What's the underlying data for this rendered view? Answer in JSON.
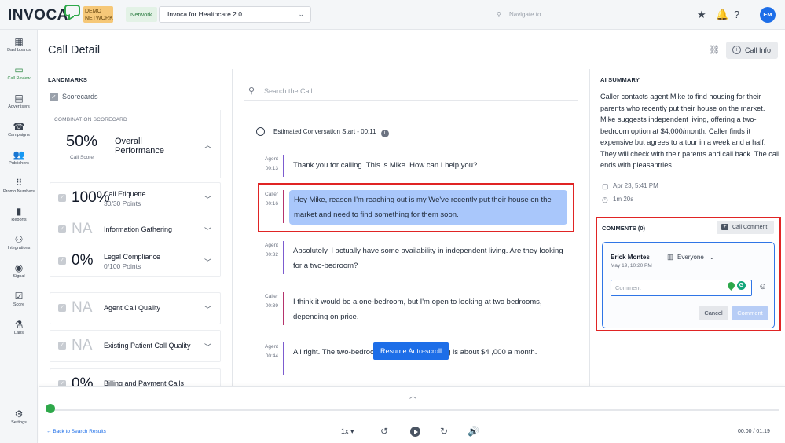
{
  "topbar": {
    "logo": "INVOCA",
    "demo_badge": "DEMO NETWORK",
    "network_label": "Network",
    "network_value": "Invoca for Healthcare 2.0",
    "search_placeholder": "Navigate to...",
    "avatar_initials": "EM"
  },
  "nav": [
    {
      "label": "Dashboards",
      "icon": "dashboard-icon",
      "glyph": "▦"
    },
    {
      "label": "Call Review",
      "icon": "call-review-icon",
      "glyph": "▭"
    },
    {
      "label": "Advertisers",
      "icon": "advertisers-icon",
      "glyph": "▤"
    },
    {
      "label": "Campaigns",
      "icon": "campaigns-icon",
      "glyph": "☎"
    },
    {
      "label": "Publishers",
      "icon": "publishers-icon",
      "glyph": "👥"
    },
    {
      "label": "Promo Numbers",
      "icon": "promo-numbers-icon",
      "glyph": "⠿"
    },
    {
      "label": "Reports",
      "icon": "reports-icon",
      "glyph": "▮"
    },
    {
      "label": "Integrations",
      "icon": "integrations-icon",
      "glyph": "⚇"
    },
    {
      "label": "Signal",
      "icon": "signal-icon",
      "glyph": "◉"
    },
    {
      "label": "Score",
      "icon": "score-icon",
      "glyph": "☑"
    },
    {
      "label": "Labs",
      "icon": "labs-icon",
      "glyph": "⚗"
    },
    {
      "label": "Settings",
      "icon": "settings-icon",
      "glyph": "⚙"
    }
  ],
  "header": {
    "title": "Call Detail",
    "call_info_label": "Call Info"
  },
  "landmarks": {
    "heading": "LANDMARKS",
    "scorecards_label": "Scorecards",
    "combo": {
      "heading": "COMBINATION SCORECARD",
      "percent": "50%",
      "sub": "Call Score",
      "name": "Overall Performance"
    },
    "rows": [
      {
        "pct": "100%",
        "name": "Call Etiquette",
        "sub": "30/30 Points"
      },
      {
        "pct": "NA",
        "name": "Information Gathering",
        "sub": ""
      },
      {
        "pct": "0%",
        "name": "Legal Compliance",
        "sub": "0/100 Points"
      },
      {
        "pct": "NA",
        "name": "Agent Call Quality",
        "sub": ""
      },
      {
        "pct": "NA",
        "name": "Existing Patient Call Quality",
        "sub": ""
      },
      {
        "pct": "0%",
        "name": "Billing and Payment Calls",
        "sub": ""
      }
    ]
  },
  "transcript": {
    "search_placeholder": "Search the Call",
    "estimated_start": "Estimated Conversation Start - 00:11",
    "turns": [
      {
        "speaker": "Agent",
        "time": "00:13",
        "text": "Thank you for calling. This is Mike. How can I help you?"
      },
      {
        "speaker": "Caller",
        "time": "00:16",
        "text": "Hey Mike, reason I'm reaching out is my We've recently put their house on the market and need to find something for them soon."
      },
      {
        "speaker": "Agent",
        "time": "00:32",
        "text": "Absolutely. I actually have some availability in independent living. Are they looking for a two-bedroom?"
      },
      {
        "speaker": "Caller",
        "time": "00:39",
        "text": "I think it would be a one-bedroom, but I'm open to looking at two bedrooms, depending on price."
      },
      {
        "speaker": "Agent",
        "time": "00:44",
        "text": "All right. The two-bedroom in independent living is about $4 ,000 a month."
      }
    ],
    "resume_label": "Resume Auto-scroll"
  },
  "ai_summary": {
    "heading": "AI SUMMARY",
    "text": "Caller contacts agent Mike to find housing for their parents who recently put their house on the market. Mike suggests independent living, offering a two-bedroom option at $4,000/month. Caller finds it expensive but agrees to a tour in a week and a half. They will check with their parents and call back. The call ends with pleasantries.",
    "date": "Apr 23, 5:41 PM",
    "duration": "1m 20s"
  },
  "comments": {
    "heading": "COMMENTS (0)",
    "call_comment_label": "Call Comment",
    "author": "Erick Montes",
    "date": "May 19, 10:20 PM",
    "visibility": "Everyone",
    "placeholder": "Comment",
    "cancel_label": "Cancel",
    "submit_label": "Comment"
  },
  "player": {
    "back_label": "Back to Search Results",
    "speed": "1x",
    "time": "00:00 / 01:19",
    "progress": 0
  }
}
